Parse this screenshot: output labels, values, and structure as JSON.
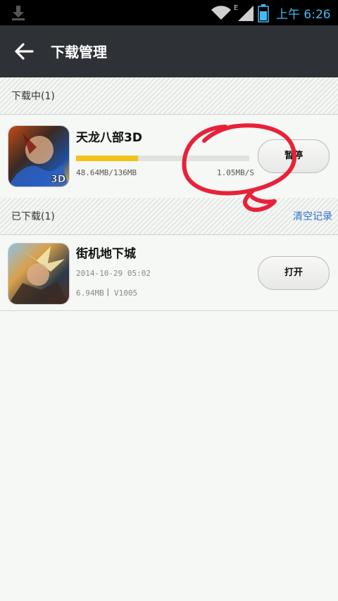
{
  "status_bar": {
    "time": "上午 6:26",
    "network_label": "E",
    "icons": [
      "download-notify-icon",
      "wifi-icon",
      "signal-icon",
      "battery-icon"
    ]
  },
  "action_bar": {
    "title": "下载管理",
    "back_icon": "back-arrow-icon"
  },
  "downloading_section": {
    "label": "下载中(1)",
    "items": [
      {
        "name": "天龙八部3D",
        "progress": 0.357,
        "size_text": "48.64MB/136MB",
        "speed": "1.05MB/S",
        "button_label": "暂停",
        "icon_badge": "3D"
      }
    ]
  },
  "downloaded_section": {
    "label": "已下载(1)",
    "clear_label": "清空记录",
    "items": [
      {
        "name": "街机地下城",
        "date": "2014-10-29 05:02",
        "size": "6.94MB",
        "version": "V1005",
        "button_label": "打开"
      }
    ]
  },
  "colors": {
    "status_time": "#48b8f0",
    "action_bar": "#2e3136",
    "progress": "#f3c21b",
    "link": "#2a6fd6",
    "annotation": "#e8213a"
  }
}
